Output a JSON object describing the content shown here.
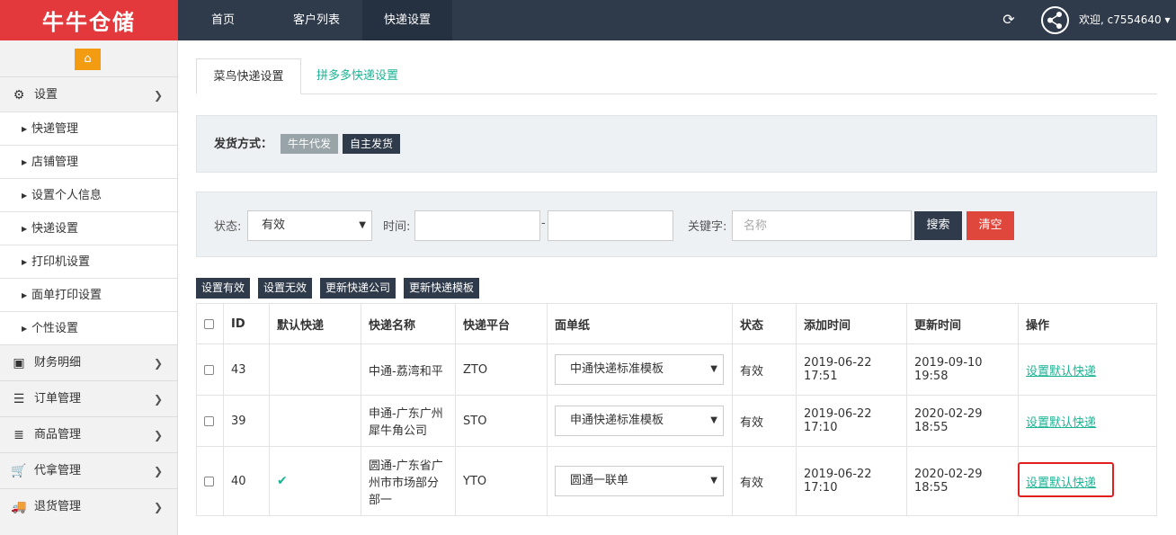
{
  "logo": {
    "text": "牛牛仓储"
  },
  "topnav": {
    "items": [
      "首页",
      "客户列表",
      "快递设置"
    ],
    "active": 2
  },
  "user": {
    "welcome": "欢迎, c7554640"
  },
  "sidebar": {
    "settings_group": "设置",
    "sub_items": [
      "快递管理",
      "店铺管理",
      "设置个人信息",
      "快递设置",
      "打印机设置",
      "面单打印设置",
      "个性设置"
    ],
    "groups": [
      "财务明细",
      "订单管理",
      "商品管理",
      "代拿管理",
      "退货管理"
    ]
  },
  "tabs": [
    "菜鸟快递设置",
    "拼多多快递设置"
  ],
  "shipping": {
    "label": "发货方式：",
    "opt1": "牛牛代发",
    "opt2": "自主发货"
  },
  "filters": {
    "status_label": "状态:",
    "status_value": "有效",
    "time_label": "时间:",
    "dash": "-",
    "keyword_label": "关键字:",
    "keyword_placeholder": "名称",
    "search": "搜索",
    "clear": "清空"
  },
  "actions": [
    "设置有效",
    "设置无效",
    "更新快递公司",
    "更新快递模板"
  ],
  "table": {
    "headers": [
      "ID",
      "默认快递",
      "快递名称",
      "快递平台",
      "面单纸",
      "状态",
      "添加时间",
      "更新时间",
      "操作"
    ],
    "rows": [
      {
        "id": "43",
        "default": false,
        "name": "中通-荔湾和平",
        "platform": "ZTO",
        "paper": "中通快递标准模板",
        "status": "有效",
        "added": "2019-06-22 17:51",
        "updated": "2019-09-10 19:58",
        "action": "设置默认快递"
      },
      {
        "id": "39",
        "default": false,
        "name": "申通-广东广州犀牛角公司",
        "platform": "STO",
        "paper": "申通快递标准模板",
        "status": "有效",
        "added": "2019-06-22 17:10",
        "updated": "2020-02-29 18:55",
        "action": "设置默认快递"
      },
      {
        "id": "40",
        "default": true,
        "name": "圆通-广东省广州市市场部分部一",
        "platform": "YTO",
        "paper": "圆通一联单",
        "status": "有效",
        "added": "2019-06-22 17:10",
        "updated": "2020-02-29 18:55",
        "action": "设置默认快递"
      }
    ]
  }
}
